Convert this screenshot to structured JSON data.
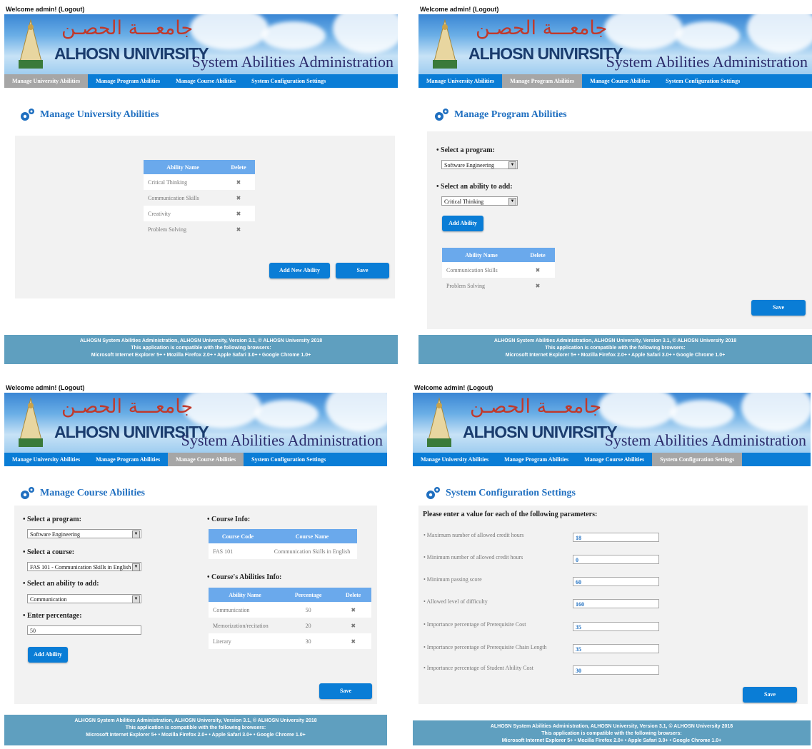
{
  "header": {
    "welcome": "Welcome admin! (Logout)",
    "arabic_name": "جامعـــة الحصـن",
    "university": "ALHOSN UNIVIRSITY",
    "system_title": "System Abilities Administration"
  },
  "nav": {
    "tabs": [
      "Manage University Abilities",
      "Manage Program Abilities",
      "Manage Course Abilities",
      "System Configuration Settings"
    ]
  },
  "footer": {
    "line1": "ALHOSN System Abilities Administration, ALHOSN University, Version 3.1, © ALHOSN University 2018",
    "line2": "This application is compatible with the following browsers:",
    "line3": "Microsoft Internet Explorer 5+ • Mozilla Firefox 2.0+ • Apple Safari 3.0+ • Google Chrome 1.0+"
  },
  "university_panel": {
    "title": "Manage University Abilities",
    "col_ability": "Ability Name",
    "col_delete": "Delete",
    "rows": [
      "Critical Thinking",
      "Communication Skills",
      "Creativity",
      "Problem Solving"
    ],
    "delete_icon": "✖",
    "add_button": "Add New Ability",
    "save_button": "Save"
  },
  "program_panel": {
    "title": "Manage Program Abilities",
    "program_label": "• Select a program:",
    "program_value": "Software Engineering",
    "ability_label": "• Select an ability to add:",
    "ability_value": "Critical Thinking",
    "add_button": "Add Ability",
    "col_ability": "Ability Name",
    "col_delete": "Delete",
    "rows": [
      "Communication Skills",
      "Problem Solving"
    ],
    "save_button": "Save"
  },
  "course_panel": {
    "title": "Manage Course Abilities",
    "program_label": "• Select a program:",
    "program_value": "Software Engineering",
    "course_label": "• Select a course:",
    "course_value": "FAS 101 - Communication Skills in English",
    "ability_label": "• Select an ability to add:",
    "ability_value": "Communication",
    "percent_label": "• Enter percentage:",
    "percent_value": "50",
    "add_button": "Add Ability",
    "course_info_label": "• Course Info:",
    "col_code": "Course Code",
    "col_name": "Course Name",
    "course_code": "FAS 101",
    "course_name": "Communication Skills in English",
    "abilities_info_label": "• Course's Abilities Info:",
    "col_ability": "Ability Name",
    "col_percentage": "Percentage",
    "col_delete": "Delete",
    "rows": [
      {
        "name": "Communication",
        "pct": "50"
      },
      {
        "name": "Memorization/recitation",
        "pct": "20"
      },
      {
        "name": "Literary",
        "pct": "30"
      }
    ],
    "save_button": "Save"
  },
  "config_panel": {
    "title": "System Configuration Settings",
    "instruction": "Please enter a value for each of the following parameters:",
    "params": [
      {
        "label": "• Maximum number of allowed credit hours",
        "value": "18"
      },
      {
        "label": "• Minimum number of allowed credit hours",
        "value": "0"
      },
      {
        "label": "• Minimum passing score",
        "value": "60"
      },
      {
        "label": "• Allowed level of difficulty",
        "value": "160"
      },
      {
        "label": "• Importance percentage of Prerequisite Cost",
        "value": "35"
      },
      {
        "label": "• Importance percentage of Prerequisite Chain Length",
        "value": "35"
      },
      {
        "label": "• Importance percentage of Student Ability Cost",
        "value": "30"
      }
    ],
    "save_button": "Save"
  }
}
